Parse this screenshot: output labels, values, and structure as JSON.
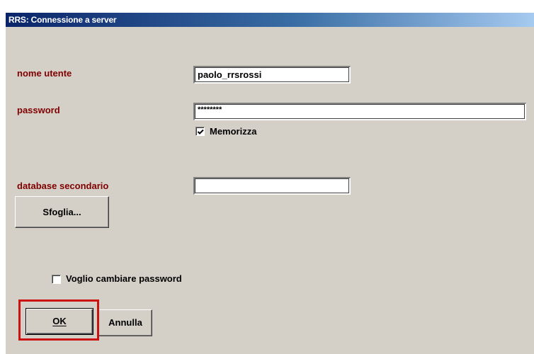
{
  "window": {
    "title": "RRS: Connessione a server"
  },
  "form": {
    "username": {
      "label": "nome utente",
      "value": "paolo_rrsrossi"
    },
    "password": {
      "label": "password",
      "value": "********"
    },
    "remember": {
      "label": "Memorizza",
      "checked": true
    },
    "secondary_db": {
      "label": "database secondario",
      "value": ""
    },
    "browse_button": "Sfoglia...",
    "change_password": {
      "label": "Voglio cambiare password",
      "checked": false
    }
  },
  "buttons": {
    "ok": "OK",
    "cancel": "Annulla"
  },
  "colors": {
    "label_color": "#800000",
    "dialog_bg": "#d4d0c8",
    "highlight": "#cc1111"
  }
}
